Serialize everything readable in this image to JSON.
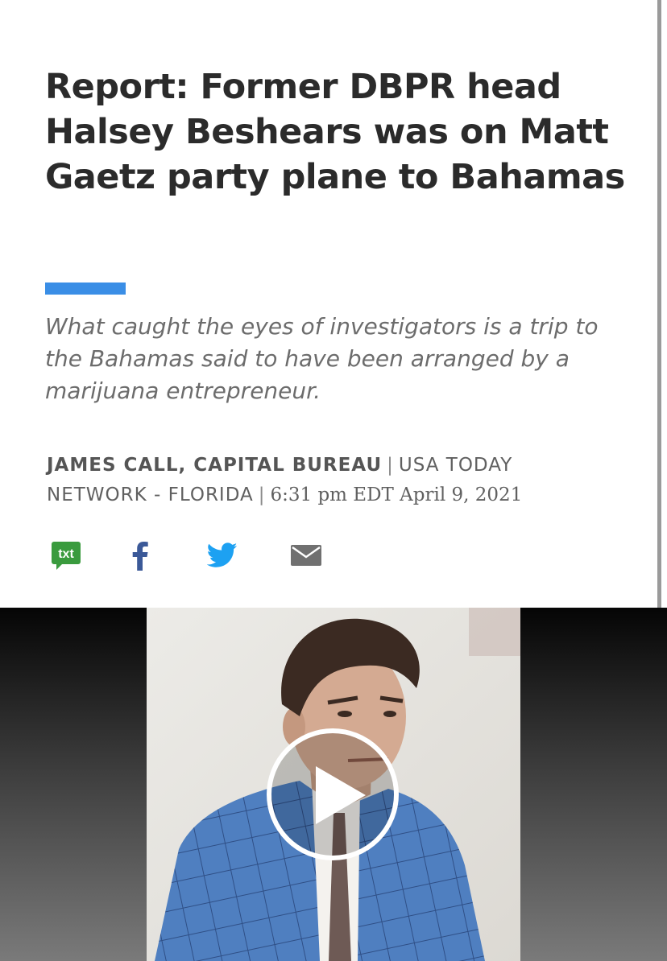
{
  "article": {
    "headline": "Report: Former DBPR head Halsey Beshears was on Matt Gaetz party plane to Bahamas",
    "summary": "What caught the eyes of investigators is a trip to the Bahamas said to have been arranged by a marijuana entrepreneur.",
    "byline": {
      "author": "JAMES CALL, CAPITAL BUREAU",
      "separator": "|",
      "organization": "USA TODAY NETWORK - FLORIDA",
      "separator2": "|",
      "published": "6:31 pm EDT April 9, 2021"
    }
  },
  "share": {
    "txt_label": "txt",
    "items": [
      {
        "icon": "txt-icon"
      },
      {
        "icon": "facebook-icon"
      },
      {
        "icon": "twitter-icon"
      },
      {
        "icon": "email-icon"
      }
    ]
  },
  "colors": {
    "accent": "#3a8ee6",
    "headline": "#2b2b2b",
    "summary": "#6c6c6c",
    "txt_green": "#3a9b3e",
    "facebook_blue": "#3b5998",
    "twitter_blue": "#1da1f2",
    "email_gray": "#707070"
  },
  "video": {
    "play_icon": "play-icon"
  }
}
